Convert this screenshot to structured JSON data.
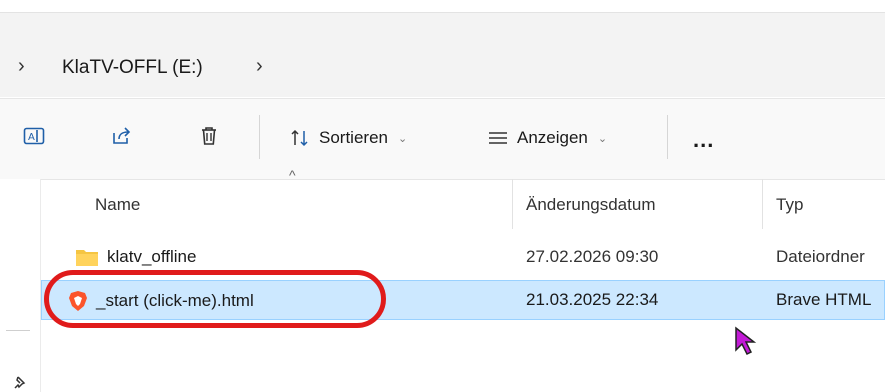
{
  "breadcrumb": {
    "drive_label": "KlaTV-OFFL (E:)"
  },
  "toolbar": {
    "rename_icon": "rename-icon",
    "share_icon": "share-icon",
    "delete_icon": "trash-icon",
    "sort_label": "Sortieren",
    "view_label": "Anzeigen",
    "more_label": "..."
  },
  "columns": {
    "name": "Name",
    "date": "Änderungsdatum",
    "type": "Typ"
  },
  "files": [
    {
      "name": "klatv_offline",
      "date": "27.02.2026 09:30",
      "type": "Dateiordner",
      "icon": "folder-icon"
    },
    {
      "name": "_start (click-me).html",
      "date": "21.03.2025 22:34",
      "type": "Brave HTML",
      "icon": "brave-icon"
    }
  ],
  "colors": {
    "selection": "#cce8ff",
    "highlight_ring": "#e01b1b",
    "cursor": "#c21ad6"
  }
}
